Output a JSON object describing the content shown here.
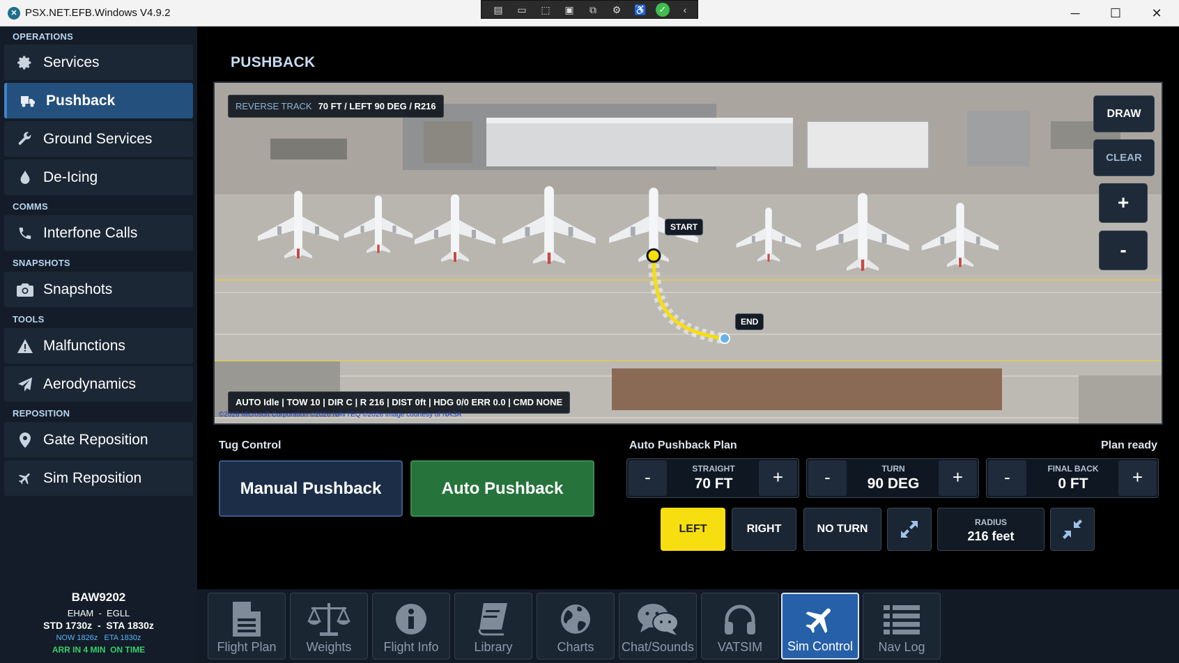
{
  "window": {
    "title": "PSX.NET.EFB.Windows V4.9.2",
    "controls": [
      "minimize",
      "maximize",
      "close"
    ]
  },
  "toolbar_icons": [
    "record-icon",
    "camera-icon",
    "pointer-icon",
    "region-icon",
    "select-icon",
    "settings-icon",
    "accessibility-icon",
    "ok-icon",
    "chevron-left-icon"
  ],
  "sidebar": {
    "sections": {
      "operations": "OPERATIONS",
      "comms": "COMMS",
      "snapshots": "SNAPSHOTS",
      "tools": "TOOLS",
      "reposition": "REPOSITION"
    },
    "items": {
      "services": "Services",
      "pushback": "Pushback",
      "ground_services": "Ground Services",
      "de_icing": "De-Icing",
      "interfone_calls": "Interfone Calls",
      "snapshots": "Snapshots",
      "malfunctions": "Malfunctions",
      "aerodynamics": "Aerodynamics",
      "gate_reposition": "Gate Reposition",
      "sim_reposition": "Sim Reposition"
    },
    "active_item": "Pushback"
  },
  "flight": {
    "callsign": "BAW9202",
    "route": "EHAM  -  EGLL",
    "schedule": "STD 1730z  -  STA 1830z",
    "now_eta": "NOW 1826z   ETA 1830z",
    "arrival_status": "ARR IN 4 MIN  ON TIME"
  },
  "page": {
    "title": "PUSHBACK"
  },
  "map": {
    "track_label": "REVERSE TRACK",
    "track_value": "70 FT / LEFT 90 DEG / R216",
    "start_label": "START",
    "end_label": "END",
    "status_line": "AUTO Idle | TOW 10 | DIR C | R 216 | DIST 0ft | HDG 0/0 ERR 0.0 | CMD NONE",
    "copyright": "©2026 Microsoft Corporation  ©2026 NAVTEQ  ©2026 Image courtesy of NASA",
    "buttons": {
      "draw": "DRAW",
      "clear": "CLEAR",
      "zoom_in": "+",
      "zoom_out": "-"
    },
    "track_color": "#f6de10"
  },
  "tug_control": {
    "label": "Tug Control",
    "manual": "Manual Pushback",
    "auto": "Auto Pushback"
  },
  "plan": {
    "label": "Auto Pushback Plan",
    "status": "Plan ready",
    "straight": {
      "caption": "STRAIGHT",
      "value": "70 FT"
    },
    "turn": {
      "caption": "TURN",
      "value": "90 DEG"
    },
    "final_back": {
      "caption": "FINAL BACK",
      "value": "0 FT"
    },
    "minus": "-",
    "plus": "+",
    "directions": {
      "left": "LEFT",
      "right": "RIGHT",
      "no_turn": "NO TURN"
    },
    "selected_direction": "LEFT",
    "radius": {
      "caption": "RADIUS",
      "value": "216 feet"
    }
  },
  "bottom_nav": [
    {
      "label": "Flight Plan",
      "icon": "document-icon"
    },
    {
      "label": "Weights",
      "icon": "scale-icon"
    },
    {
      "label": "Flight Info",
      "icon": "info-icon"
    },
    {
      "label": "Library",
      "icon": "book-icon"
    },
    {
      "label": "Charts",
      "icon": "globe-icon"
    },
    {
      "label": "Chat/Sounds",
      "icon": "chat-icon"
    },
    {
      "label": "VATSIM",
      "icon": "headset-icon"
    },
    {
      "label": "Sim Control",
      "icon": "plane-icon"
    },
    {
      "label": "Nav Log",
      "icon": "list-icon"
    }
  ],
  "bottom_nav_active": "Sim Control",
  "colors": {
    "accent_blue": "#24507e",
    "auto_green": "#26733c",
    "selected_yellow": "#f6de10"
  }
}
